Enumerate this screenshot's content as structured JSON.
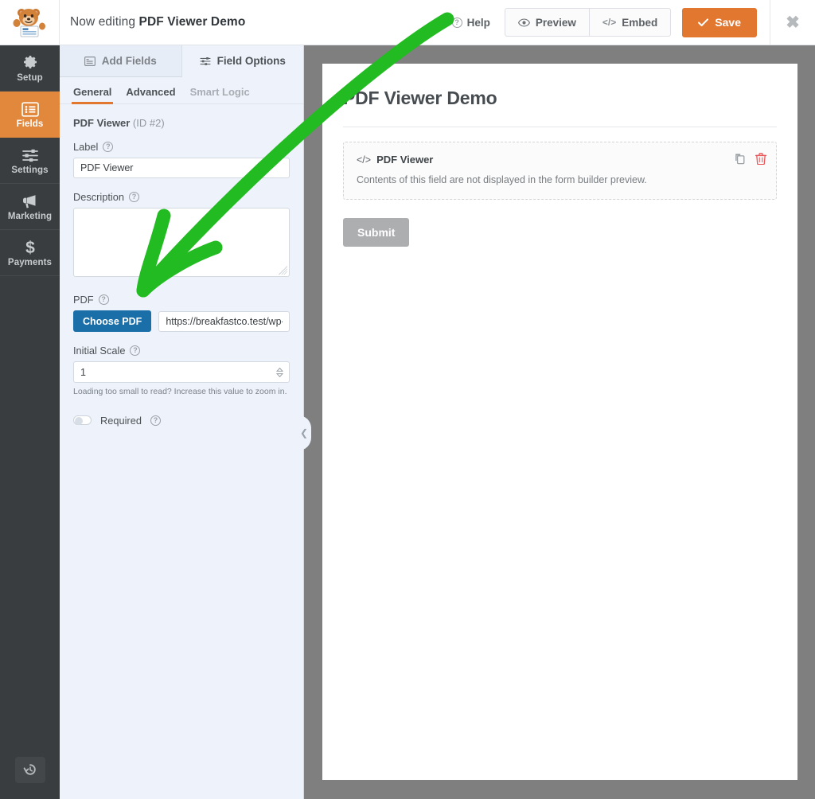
{
  "topbar": {
    "logo_icon": "wpforms-bear-mascot-logo",
    "editing_prefix": "Now editing",
    "form_name": "PDF Viewer Demo",
    "help_label": "Help",
    "help_icon": "question-circle-icon",
    "preview_label": "Preview",
    "preview_icon": "eye-icon",
    "embed_label": "Embed",
    "embed_icon": "code-brackets-icon",
    "save_label": "Save",
    "save_icon": "check-icon",
    "close_icon": "close-x-icon",
    "save_color": "#e27730"
  },
  "sidebar": {
    "items": [
      {
        "label": "Setup",
        "icon": "gear-icon",
        "active": false
      },
      {
        "label": "Fields",
        "icon": "list-form-icon",
        "active": true
      },
      {
        "label": "Settings",
        "icon": "sliders-icon",
        "active": false
      },
      {
        "label": "Marketing",
        "icon": "megaphone-icon",
        "active": false
      },
      {
        "label": "Payments",
        "icon": "dollar-icon",
        "active": false
      }
    ],
    "active_color": "#e2883c",
    "background_color": "#393d3f",
    "history_icon": "revision-history-icon"
  },
  "panel": {
    "tabs": [
      {
        "label": "Add Fields",
        "icon": "fields-grid-icon",
        "active": false
      },
      {
        "label": "Field Options",
        "icon": "sliders-icon",
        "active": true
      }
    ],
    "subtabs": [
      {
        "label": "General",
        "active": true,
        "muted": false
      },
      {
        "label": "Advanced",
        "active": false,
        "muted": false
      },
      {
        "label": "Smart Logic",
        "active": false,
        "muted": true
      }
    ],
    "field_heading": "PDF Viewer",
    "field_id": "(ID #2)",
    "label_field": {
      "label": "Label",
      "value": "PDF Viewer",
      "help_icon": "question-circle-icon"
    },
    "description_field": {
      "label": "Description",
      "value": "",
      "help_icon": "question-circle-icon"
    },
    "pdf_field": {
      "label": "PDF",
      "help_icon": "question-circle-icon",
      "button_label": "Choose PDF",
      "button_color": "#1a6fa8",
      "url_value": "https://breakfastco.test/wp-conte"
    },
    "initial_scale_field": {
      "label": "Initial Scale",
      "help_icon": "question-circle-icon",
      "value": "1",
      "helper_text": "Loading too small to read? Increase this value to zoom in.",
      "spinner_icon": "number-spinner-icon"
    },
    "required_toggle": {
      "label": "Required",
      "help_icon": "question-circle-icon",
      "enabled": false
    },
    "collapse_icon": "chevron-left-icon",
    "background_color": "#eef3fb"
  },
  "preview": {
    "background_color": "#7f7f7f",
    "form_title": "PDF Viewer Demo",
    "field": {
      "icon": "code-brackets-icon",
      "title": "PDF Viewer",
      "description": "Contents of this field are not displayed in the form builder preview.",
      "duplicate_icon": "duplicate-icon",
      "delete_icon": "trash-icon",
      "delete_color": "#e8575a"
    },
    "submit_label": "Submit"
  },
  "annotation": {
    "arrow_icon": "green-arrow-annotation",
    "color": "#22bb22"
  }
}
